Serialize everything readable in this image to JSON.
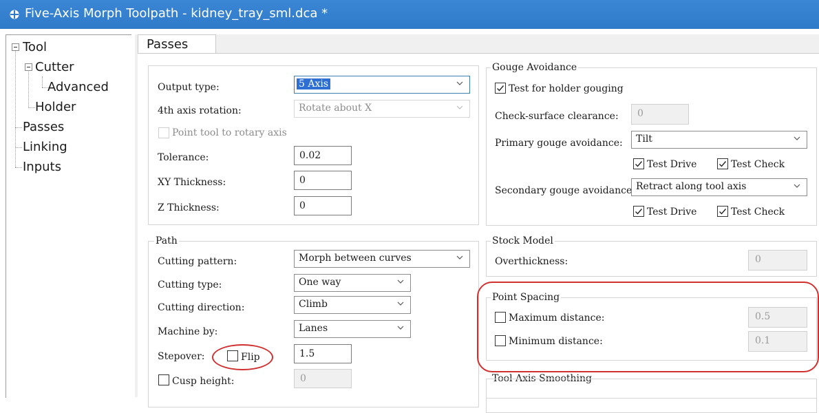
{
  "window": {
    "title": "Five-Axis Morph Toolpath - kidney_tray_sml.dca *"
  },
  "tree": {
    "items": [
      "Tool",
      "Cutter",
      "Advanced",
      "Holder",
      "Passes",
      "Linking",
      "Inputs"
    ]
  },
  "tab": {
    "label": "Passes"
  },
  "output": {
    "output_type_label": "Output type:",
    "output_type_value": "5 Axis",
    "rotation_label": "4th axis rotation:",
    "rotation_value": "Rotate  about X",
    "point_tool_label": "Point tool to rotary axis",
    "tolerance_label": "Tolerance:",
    "tolerance_value": "0.02",
    "xy_label": "XY Thickness:",
    "xy_value": "0",
    "z_label": "Z Thickness:",
    "z_value": "0"
  },
  "path": {
    "title": "Path",
    "pattern_label": "Cutting pattern:",
    "pattern_value": "Morph between curves",
    "type_label": "Cutting type:",
    "type_value": "One way",
    "direction_label": "Cutting direction:",
    "direction_value": "Climb",
    "machine_label": "Machine by:",
    "machine_value": "Lanes",
    "stepover_label": "Stepover:",
    "flip_label": "Flip",
    "stepover_value": "1.5",
    "cusp_label": "Cusp height:",
    "cusp_value": "0"
  },
  "gouge": {
    "title": "Gouge Avoidance",
    "holder_label": "Test for holder gouging",
    "clearance_label": "Check-surface clearance:",
    "clearance_value": "0",
    "primary_label": "Primary gouge avoidance:",
    "primary_value": "Tilt",
    "test_drive_label": "Test Drive",
    "test_check_label": "Test Check",
    "secondary_label": "Secondary gouge avoidance:",
    "secondary_value": "Retract along tool axis",
    "test_drive2_label": "Test Drive",
    "test_check2_label": "Test Check"
  },
  "stock": {
    "title": "Stock Model",
    "over_label": "Overthickness:",
    "over_value": "0"
  },
  "spacing": {
    "title": "Point Spacing",
    "max_label": "Maximum distance:",
    "max_value": "0.5",
    "min_label": "Minimum distance:",
    "min_value": "0.1"
  },
  "smoothing": {
    "title": "Tool Axis Smoothing"
  },
  "colors": {
    "titlebar": "#2f7bca",
    "highlight": "#2d6fd2",
    "annotation": "#d03030"
  }
}
